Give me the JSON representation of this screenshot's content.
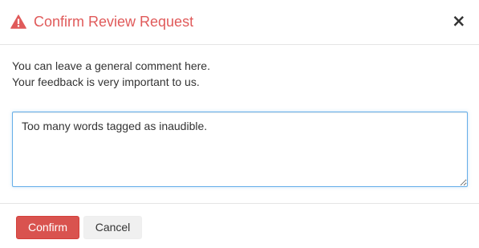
{
  "dialog": {
    "title": "Confirm Review Request",
    "close_label": "×",
    "accent_color": "#e05a5a"
  },
  "body": {
    "line1": "You can leave a general comment here.",
    "line2": "Your feedback is very important to us.",
    "comment_value": "Too many words tagged as inaudible."
  },
  "footer": {
    "confirm_label": "Confirm",
    "cancel_label": "Cancel"
  },
  "icons": {
    "title_icon": "warning-triangle-icon",
    "close_icon": "close-icon"
  }
}
